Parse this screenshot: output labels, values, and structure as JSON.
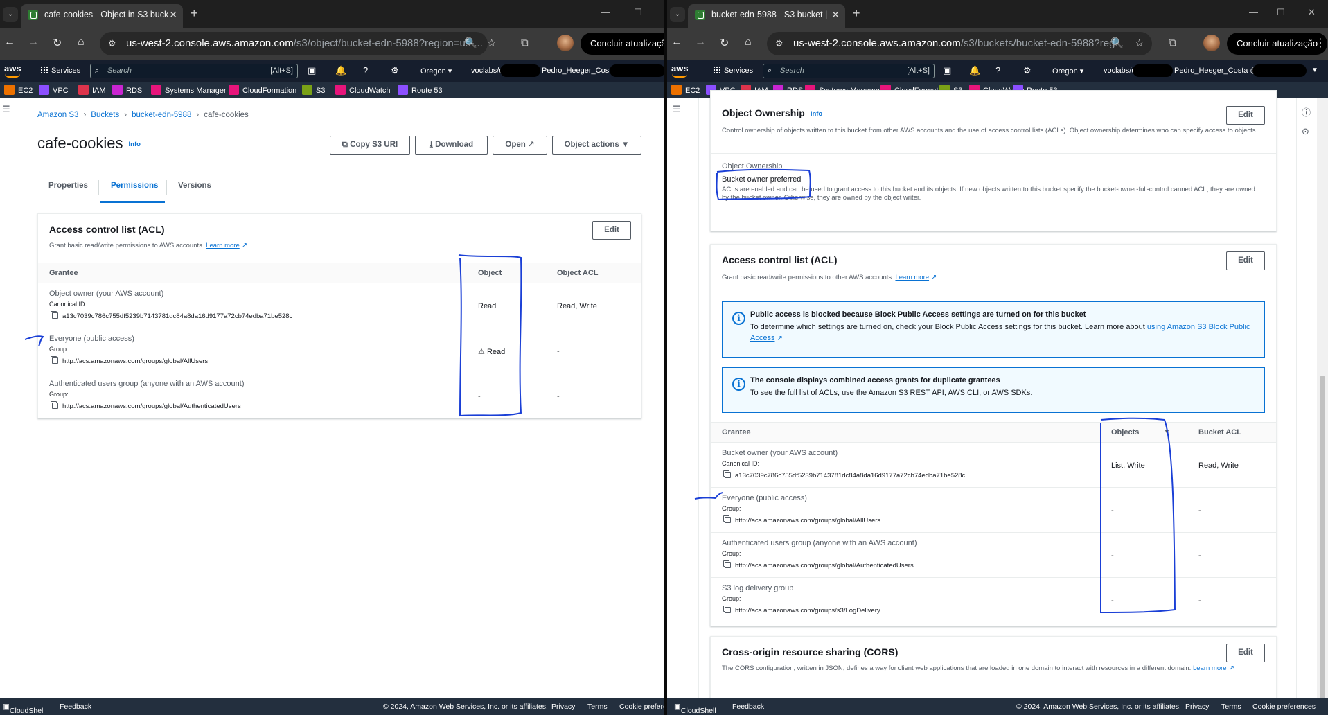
{
  "left": {
    "tab_title": "cafe-cookies - Object in S3 buck",
    "url_host": "us-west-2.console.aws.amazon.com",
    "url_path": "/s3/object/bucket-edn-5988?region=us-...",
    "update_label": "Concluir atualização",
    "search_placeholder": "Search",
    "search_shortcut": "[Alt+S]",
    "services_label": "Services",
    "region": "Oregon",
    "account": "voclabs/us",
    "account_name": "Pedro_Heeger_Costa @",
    "favorites": [
      "EC2",
      "VPC",
      "IAM",
      "RDS",
      "Systems Manager",
      "CloudFormation",
      "S3",
      "CloudWatch",
      "Route 53"
    ],
    "breadcrumb": [
      "Amazon S3",
      "Buckets",
      "bucket-edn-5988",
      "cafe-cookies"
    ],
    "title": "cafe-cookies",
    "info": "Info",
    "buttons": {
      "copy_uri": "Copy S3 URI",
      "download": "Download",
      "open": "Open",
      "object_actions": "Object actions"
    },
    "tabs": [
      "Properties",
      "Permissions",
      "Versions"
    ],
    "acl": {
      "title": "Access control list (ACL)",
      "edit": "Edit",
      "desc": "Grant basic read/write permissions to AWS accounts.",
      "learn_more": "Learn more",
      "columns": [
        "Grantee",
        "Object",
        "Object ACL"
      ],
      "rows": [
        {
          "grantee": "Object owner (your AWS account)",
          "label": "Canonical ID:",
          "value": "a13c7039c786c755df5239b7143781dc84a8da16d9177a72cb74edba71be528c",
          "object": "Read",
          "object_acl": "Read, Write"
        },
        {
          "grantee": "Everyone (public access)",
          "label": "Group:",
          "value": "http://acs.amazonaws.com/groups/global/AllUsers",
          "object": "Read",
          "object_acl": "-"
        },
        {
          "grantee": "Authenticated users group (anyone with an AWS account)",
          "label": "Group:",
          "value": "http://acs.amazonaws.com/groups/global/AuthenticatedUsers",
          "object": "-",
          "object_acl": "-"
        }
      ]
    },
    "footer": {
      "cloudshell": "CloudShell",
      "feedback": "Feedback",
      "copyright": "© 2024, Amazon Web Services, Inc. or its affiliates.",
      "privacy": "Privacy",
      "terms": "Terms",
      "cookies": "Cookie preferer"
    }
  },
  "right": {
    "tab_title": "bucket-edn-5988 - S3 bucket |",
    "url_host": "us-west-2.console.aws.amazon.com",
    "url_path": "/s3/buckets/bucket-edn-5988?reg...",
    "update_label": "Concluir atualização",
    "search_placeholder": "Search",
    "search_shortcut": "[Alt+S]",
    "services_label": "Services",
    "region": "Oregon",
    "account": "voclabs/us",
    "account_name": "Pedro_Heeger_Costa @",
    "favorites": [
      "EC2",
      "VPC",
      "IAM",
      "RDS",
      "Systems Manager",
      "CloudFormation",
      "S3",
      "CloudWatch",
      "Route 53"
    ],
    "ownership": {
      "title": "Object Ownership",
      "info": "Info",
      "edit": "Edit",
      "desc": "Control ownership of objects written to this bucket from other AWS accounts and the use of access control lists (ACLs). Object ownership determines who can specify access to objects.",
      "label": "Object Ownership",
      "value": "Bucket owner preferred",
      "note": "ACLs are enabled and can be used to grant access to this bucket and its objects. If new objects written to this bucket specify the bucket-owner-full-control canned ACL, they are owned by the bucket owner. Otherwise, they are owned by the object writer."
    },
    "acl": {
      "title": "Access control list (ACL)",
      "edit": "Edit",
      "desc": "Grant basic read/write permissions to other AWS accounts.",
      "learn_more": "Learn more",
      "alert1_title": "Public access is blocked because Block Public Access settings are turned on for this bucket",
      "alert1_body": "To determine which settings are turned on, check your Block Public Access settings for this bucket. Learn more about",
      "alert1_link": "using Amazon S3 Block Public Access",
      "alert2_title": "The console displays combined access grants for duplicate grantees",
      "alert2_body": "To see the full list of ACLs, use the Amazon S3 REST API, AWS CLI, or AWS SDKs.",
      "columns": [
        "Grantee",
        "Objects",
        "Bucket ACL"
      ],
      "rows": [
        {
          "grantee": "Bucket owner (your AWS account)",
          "label": "Canonical ID:",
          "value": "a13c7039c786c755df5239b7143781dc84a8da16d9177a72cb74edba71be528c",
          "objects": "List, Write",
          "bucket_acl": "Read, Write"
        },
        {
          "grantee": "Everyone (public access)",
          "label": "Group:",
          "value": "http://acs.amazonaws.com/groups/global/AllUsers",
          "objects": "-",
          "bucket_acl": "-"
        },
        {
          "grantee": "Authenticated users group (anyone with an AWS account)",
          "label": "Group:",
          "value": "http://acs.amazonaws.com/groups/global/AuthenticatedUsers",
          "objects": "-",
          "bucket_acl": "-"
        },
        {
          "grantee": "S3 log delivery group",
          "label": "Group:",
          "value": "http://acs.amazonaws.com/groups/s3/LogDelivery",
          "objects": "-",
          "bucket_acl": "-"
        }
      ]
    },
    "cors": {
      "title": "Cross-origin resource sharing (CORS)",
      "edit": "Edit",
      "desc": "The CORS configuration, written in JSON, defines a way for client web applications that are loaded in one domain to interact with resources in a different domain.",
      "learn_more": "Learn more"
    },
    "footer": {
      "cloudshell": "CloudShell",
      "feedback": "Feedback",
      "copyright": "© 2024, Amazon Web Services, Inc. or its affiliates.",
      "privacy": "Privacy",
      "terms": "Terms",
      "cookies": "Cookie preferences"
    }
  },
  "colors": {
    "aws_nav": "#161e2d",
    "link": "#0972d3",
    "warning": "#d13212",
    "annotation_ink": "#1a3fd6"
  }
}
